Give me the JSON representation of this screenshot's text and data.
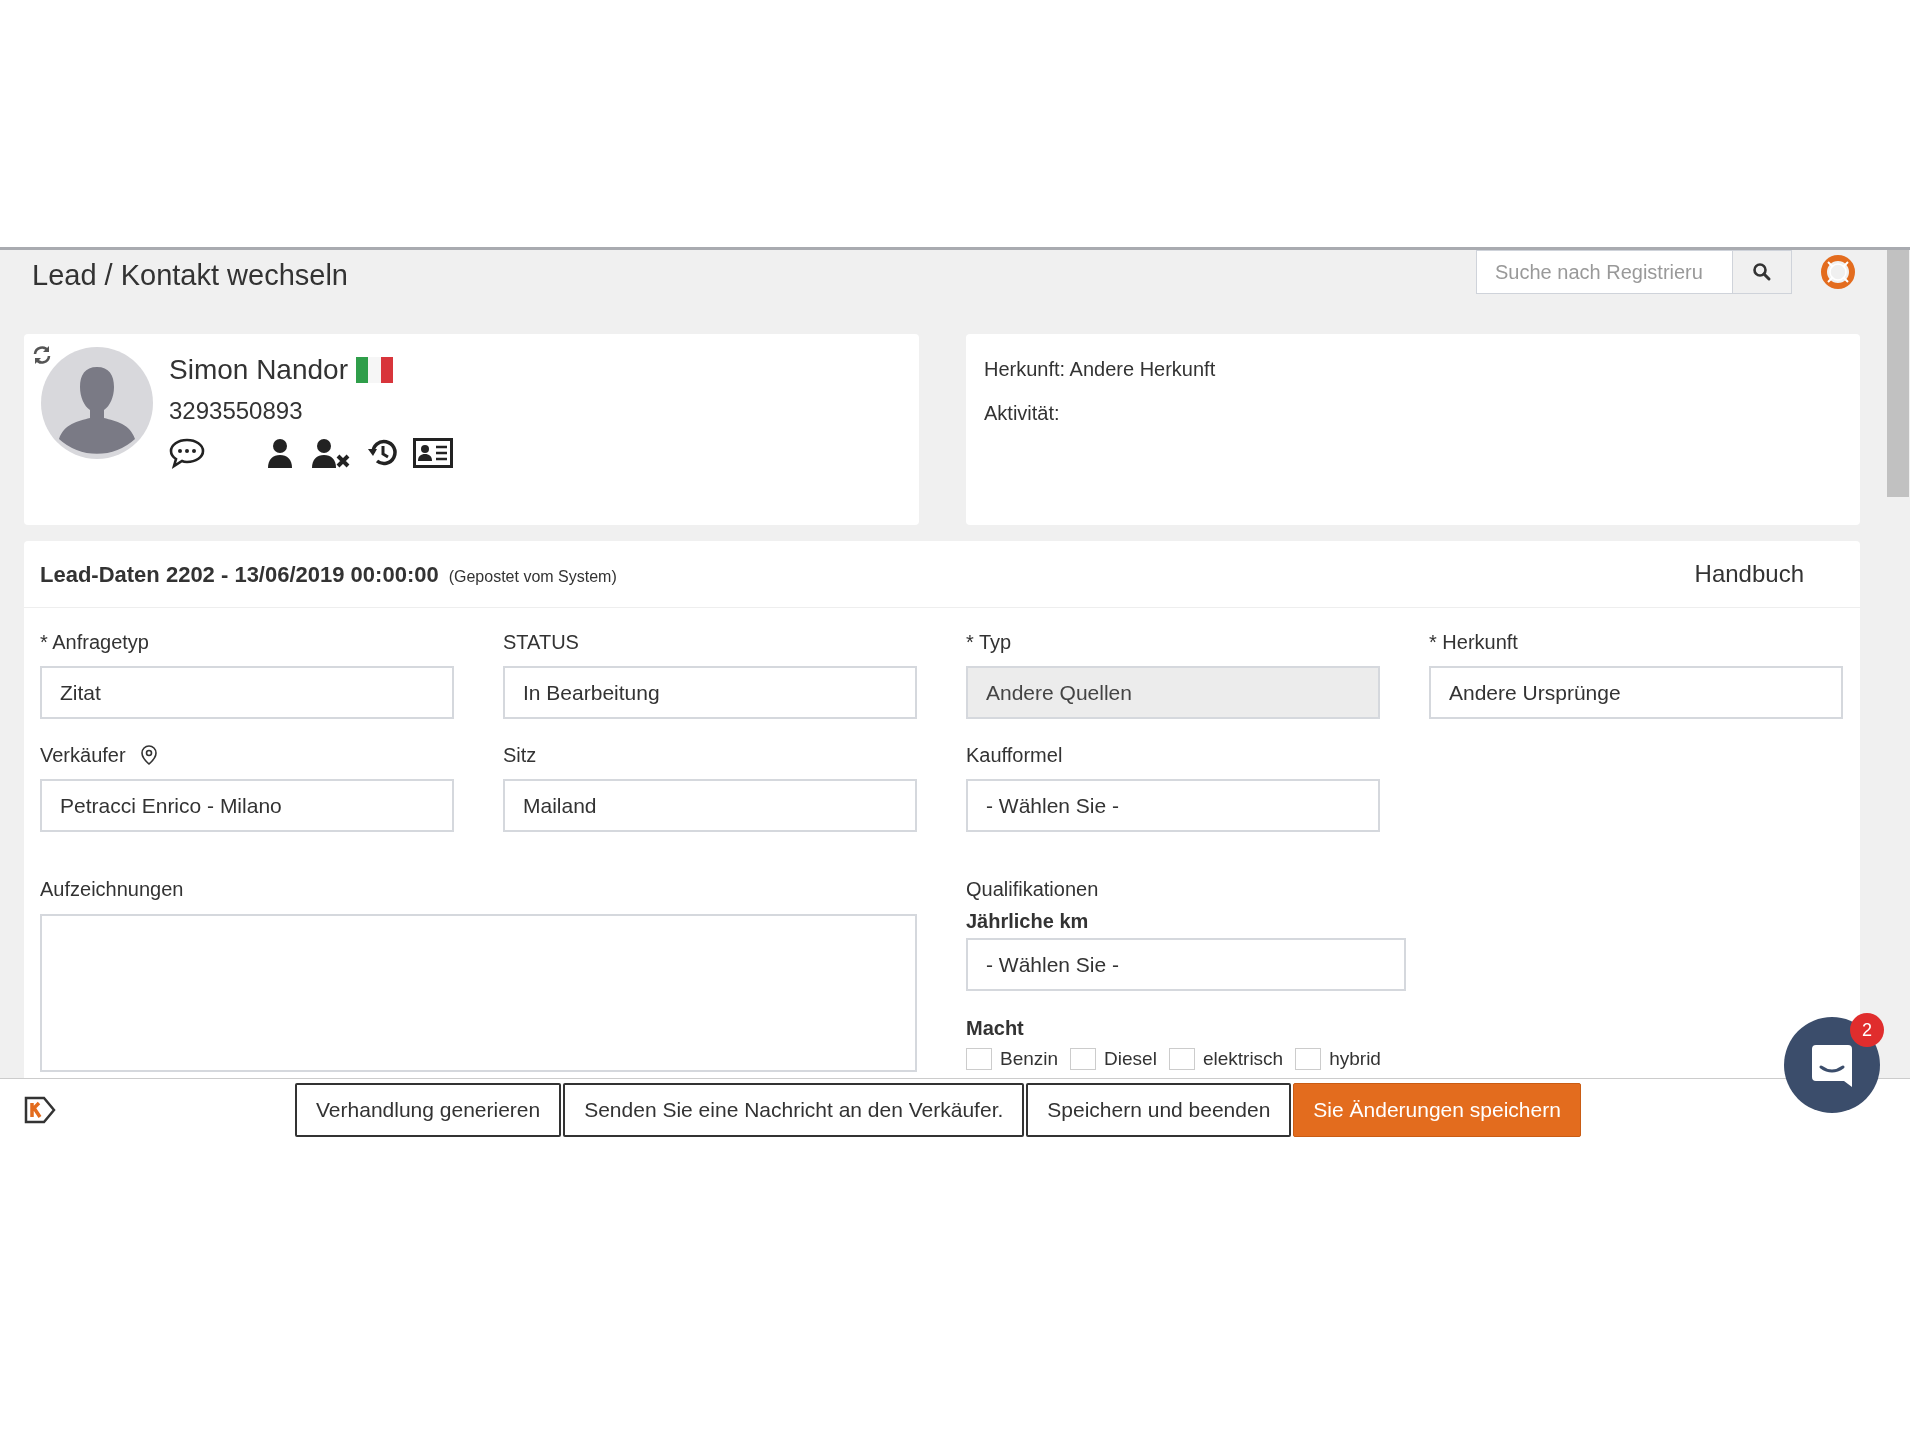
{
  "header": {
    "title": "Lead / Kontakt wechseln",
    "search": {
      "placeholder": "Suche nach Registrieru"
    }
  },
  "contact": {
    "name": "Simon Nandor",
    "phone": "3293550893"
  },
  "info": [
    "Herkunft: Andere Herkunft",
    "Aktivität:"
  ],
  "lead": {
    "title": "Lead-Daten 2202 - 13/06/2019 00:00:00",
    "note": "(Gepostet vom System)",
    "manual": "Handbuch"
  },
  "fields": [
    {
      "label": "* Anfragetyp",
      "value": "Zitat",
      "disabled": false,
      "kind": "plain"
    },
    {
      "label": "STATUS",
      "value": "In Bearbeitung",
      "disabled": false,
      "kind": "plain"
    },
    {
      "label": "* Typ",
      "value": "Andere Quellen",
      "disabled": true,
      "kind": "plain"
    },
    {
      "label": "* Herkunft",
      "value": "Andere Ursprünge",
      "disabled": false,
      "kind": "plain"
    },
    {
      "label": "Verkäufer",
      "value": "Petracci Enrico - Milano",
      "disabled": false,
      "kind": "location"
    },
    {
      "label": "Sitz",
      "value": "Mailand",
      "disabled": false,
      "kind": "plain"
    },
    {
      "label": "Kaufformel",
      "value": "- Wählen Sie -",
      "disabled": false,
      "kind": "plain"
    }
  ],
  "notes": {
    "label": "Aufzeichnungen"
  },
  "qualifications": {
    "label": "Qualifikationen",
    "km": {
      "label": "Jährliche km",
      "value": "- Wählen Sie -"
    },
    "power": {
      "label": "Macht",
      "options": [
        {
          "label": "Benzin",
          "checked": false
        },
        {
          "label": "Diesel",
          "checked": false
        },
        {
          "label": "elektrisch",
          "checked": false
        },
        {
          "label": "hybrid",
          "checked": false
        }
      ]
    }
  },
  "footer": {
    "buttons": [
      {
        "label": "Verhandlung generieren",
        "kind": "outline"
      },
      {
        "label": "Senden Sie eine Nachricht an den Verkäufer.",
        "kind": "outline"
      },
      {
        "label": "Speichern und beenden",
        "kind": "outline"
      },
      {
        "label": "Sie Änderungen speichern",
        "kind": "primary"
      }
    ]
  },
  "chat": {
    "badge": "2"
  }
}
